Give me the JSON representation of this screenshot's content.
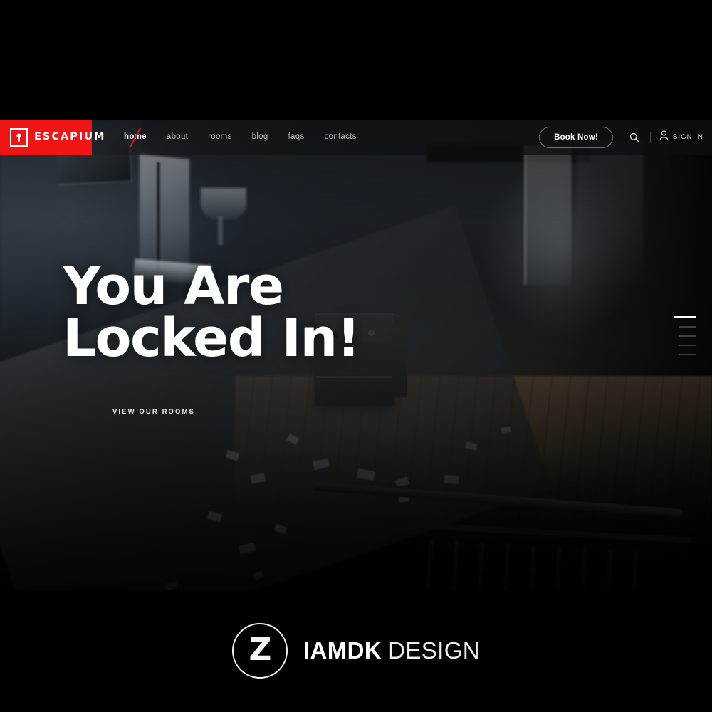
{
  "brand": {
    "logo_text": "ESCAPIUM",
    "logo_icon": "keyhole-icon",
    "logo_bg_color": "#f01414"
  },
  "nav": {
    "links": [
      {
        "label": "home",
        "active": true
      },
      {
        "label": "about",
        "active": false
      },
      {
        "label": "rooms",
        "active": false
      },
      {
        "label": "blog",
        "active": false
      },
      {
        "label": "faqs",
        "active": false
      },
      {
        "label": "contacts",
        "active": false
      }
    ],
    "book_label": "Book Now!",
    "search_icon": "search-icon",
    "signin_icon": "user-icon",
    "signin_label": "SIGN IN"
  },
  "hero": {
    "title": "You Are\nLocked In!",
    "cta_label": "VIEW OUR ROOMS",
    "scene": "dark abandoned building interior with staircase railing, wooden floor and scattered papers"
  },
  "slider": {
    "slides": [
      {
        "active": true
      },
      {
        "active": false
      },
      {
        "active": false
      },
      {
        "active": false
      },
      {
        "active": false
      }
    ]
  },
  "footer": {
    "mark_letter": "Z",
    "name_bold": "IAMDK",
    "name_light": "DESIGN"
  }
}
